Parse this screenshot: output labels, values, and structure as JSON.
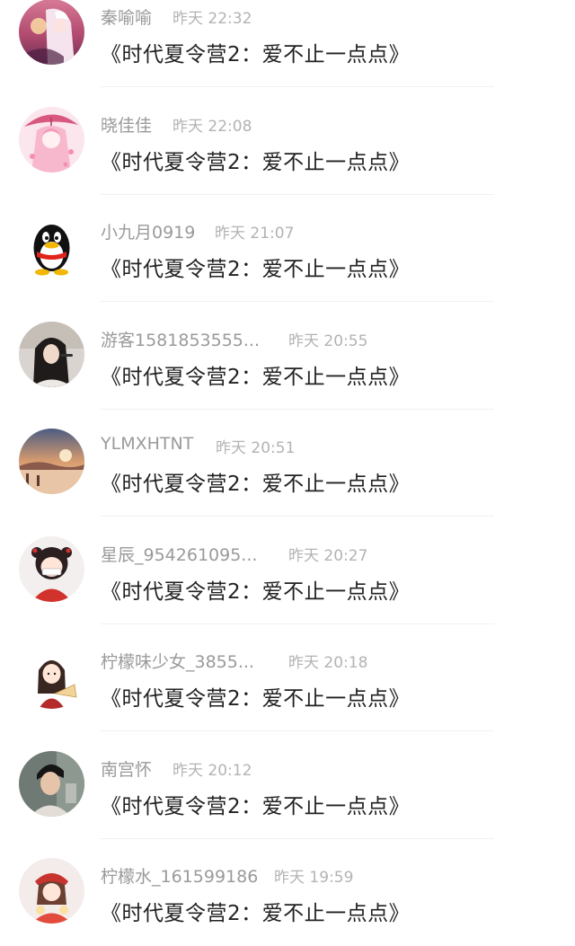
{
  "comments": [
    {
      "user": "秦喻喻",
      "time": "昨天 22:32",
      "text": "《时代夏令营2：爱不止一点点》",
      "avatar": "anime-girl-sunset-avatar"
    },
    {
      "user": "晓佳佳",
      "time": "昨天 22:08",
      "text": "《时代夏令营2：爱不止一点点》",
      "avatar": "anime-girl-pink-umbrella-avatar"
    },
    {
      "user": "小九月0919",
      "time": "昨天 21:07",
      "text": "《时代夏令营2：爱不止一点点》",
      "avatar": "qq-penguin-avatar"
    },
    {
      "user": "游客1581853555...",
      "time": "昨天 20:55",
      "text": "《时代夏令营2：爱不止一点点》",
      "avatar": "photo-girl-microphone-avatar"
    },
    {
      "user": "YLMXHTNT",
      "time": "昨天 20:51",
      "text": "《时代夏令营2：爱不止一点点》",
      "avatar": "sunset-bridge-photo-avatar"
    },
    {
      "user": "星辰_954261095...",
      "time": "昨天 20:27",
      "text": "《时代夏令营2：爱不止一点点》",
      "avatar": "cartoon-girl-red-avatar"
    },
    {
      "user": "柠檬味少女_3855...",
      "time": "昨天 20:18",
      "text": "《时代夏令营2：爱不止一点点》",
      "avatar": "cartoon-girl-fan-avatar"
    },
    {
      "user": "南宫怀",
      "time": "昨天 20:12",
      "text": "《时代夏令营2：爱不止一点点》",
      "avatar": "photo-boy-avatar"
    },
    {
      "user": "柠檬水_161599186",
      "time": "昨天 19:59",
      "text": "《时代夏令营2：爱不止一点点》",
      "avatar": "cartoon-girl-red-hat-avatar"
    }
  ]
}
